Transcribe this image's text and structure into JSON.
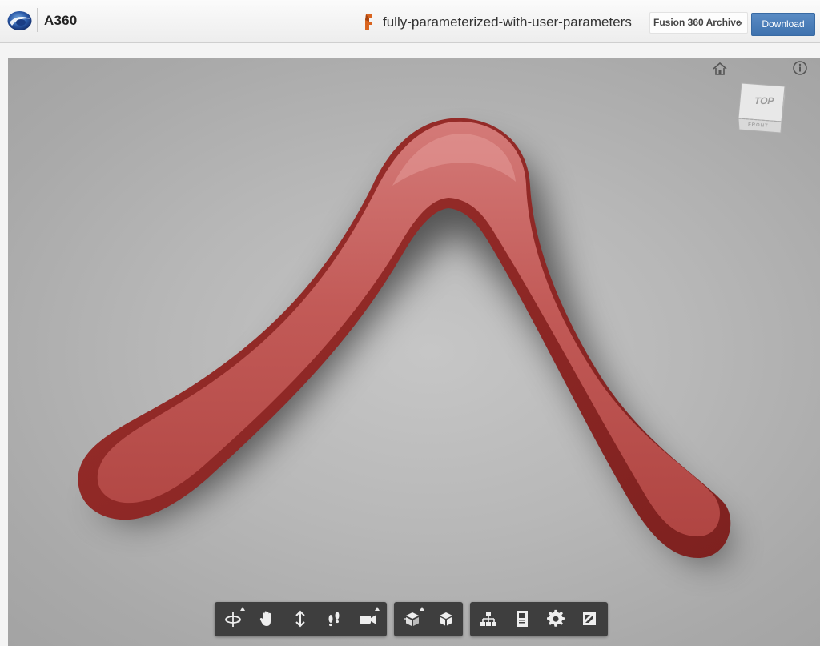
{
  "header": {
    "app_name": "A360",
    "file_title": "fully-parameterized-with-user-parameters",
    "format_select_value": "Fusion 360 Archive",
    "download_label": "Download"
  },
  "viewer": {
    "view_cube": {
      "top_label": "TOP",
      "front_label": "FRONT"
    },
    "model_color": "#b5403e",
    "background_color": "#b7b7b7"
  },
  "toolbar": {
    "groups": [
      [
        "orbit-icon",
        "pan-icon",
        "zoom-icon",
        "first-person-icon",
        "camera-icon"
      ],
      [
        "explode-icon",
        "section-icon"
      ],
      [
        "model-browser-icon",
        "properties-icon",
        "settings-icon",
        "fullscreen-icon"
      ]
    ]
  },
  "colors": {
    "accent": "#4a7ebb",
    "toolbar_bg": "#3e3e3e",
    "file_icon": "#d9641f"
  }
}
